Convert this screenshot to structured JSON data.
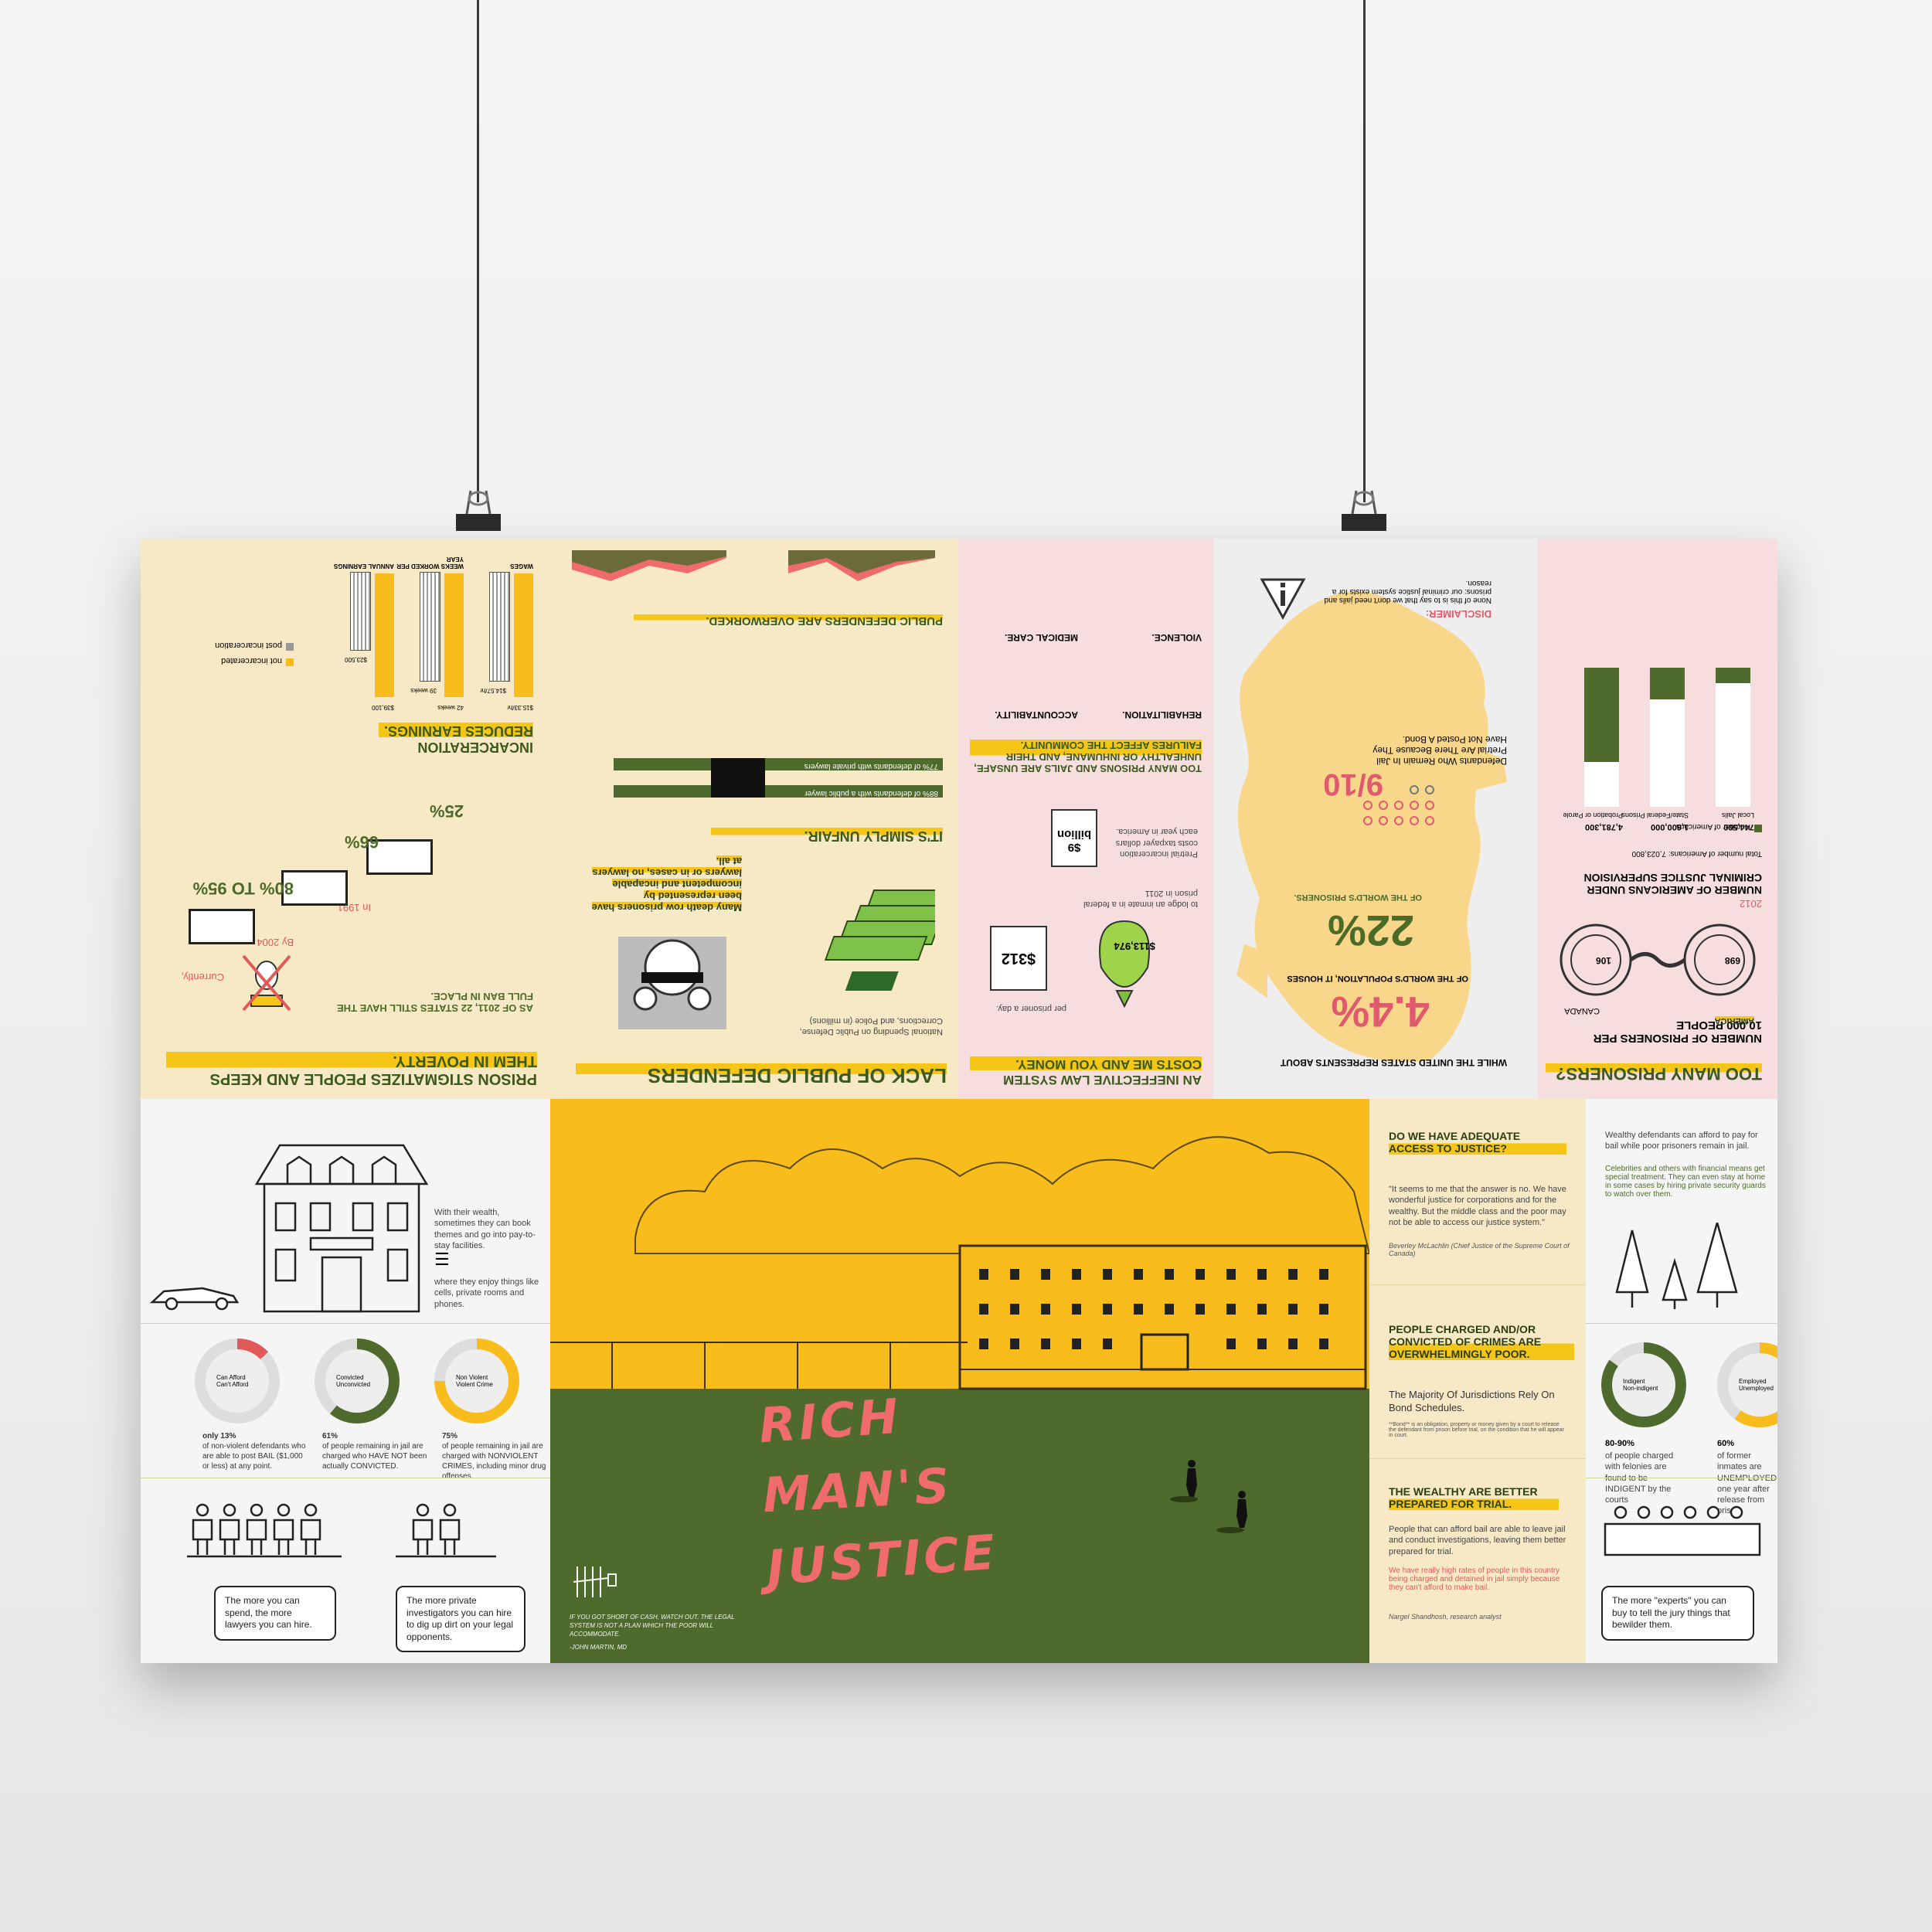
{
  "poster": {
    "title_lines": [
      "RICH",
      "MAN'S",
      "JUSTICE"
    ],
    "quote": "IF YOU GOT SHORT OF CASH, WATCH OUT. THE LEGAL SYSTEM IS NOT A PLAN WHICH THE POOR WILL ACCOMMODATE.",
    "quote_author": "-JOHN MARTIN, MD"
  },
  "upper": {
    "too_many_prisoners": {
      "heading": "TOO MANY PRISONERS?",
      "per10000_title": "NUMBER OF PRISONERS PER 10,000 PEOPLE",
      "america_label": "AMERICA",
      "america_value": "698",
      "canada_label": "CANADA",
      "canada_value": "106",
      "supervision_title": "NUMBER OF AMERICANS UNDER CRIMINAL JUSTICE SUPERVISION",
      "supervision_year": "2012",
      "supervision_total": "Total number of Americans: 7,023,800",
      "legend": "Number of Americans",
      "bars": [
        {
          "label": "Local Jails",
          "value": "744,500",
          "fraction": 0.11
        },
        {
          "label": "State/Federal Prisons",
          "value": "1,600,000",
          "fraction": 0.23
        },
        {
          "label": "Probation or Parole",
          "value": "4,781,300",
          "fraction": 0.68
        }
      ]
    },
    "map": {
      "intro": "WHILE THE UNITED STATES REPRESENTS ABOUT",
      "pct1": "4.4%",
      "pct1_caption": "OF THE WORLD'S POPULATION, IT HOUSES",
      "pct2": "22%",
      "pct2_caption": "OF THE WORLD'S PRISONERS.",
      "fraction": "9/10",
      "fraction_caption": "Defendants Who Remain In Jail Pretrial Are There Because They Have Not Posted A Bond.",
      "disclaimer_label": "DISCLAIMER:",
      "disclaimer_text": "None of this is to say that we don't need jails and prisons: our criminal justice system exists for a reason."
    },
    "ineffective": {
      "heading": "AN INEFFECTIVE LAW SYSTEM COSTS ME AND YOU MONEY.",
      "too_many_heading": "TOO MANY PRISONS AND JAILS ARE UNSAFE, UNHEALTHY OR INHUMANE, AND THEIR FAILURES AFFECT THE COMMUNITY.",
      "cost1_value": "$312",
      "cost1_caption": "per prisoner a day.",
      "cost2_value": "$113,974",
      "cost2_caption": "to lodge an inmate in a federal prison in 2011",
      "cost3_value": "$9 billion",
      "cost3_caption": "Pretrial incarceration costs taxpayer dollars each year in America.",
      "items": [
        "REHABILITATION.",
        "ACCOUNTABILITY.",
        "VIOLENCE.",
        "MEDICAL CARE."
      ]
    },
    "public_defenders": {
      "heading": "LACK OF PUBLIC DEFENDERS",
      "overworked": "PUBLIC DEFENDERS ARE OVERWORKED.",
      "unfair": "IT'S SIMPLY UNFAIR.",
      "death_row": "Many death row prisoners have been represented by incompetent and incapable lawyers or in cases, no lawyers at all.",
      "spending_caption": "National Spending on Public Defense, Corrections, and Police (in millions)",
      "bar1": "77% of defendants with private lawyers",
      "bar2": "88% of defendants with a public lawyer"
    },
    "stigma": {
      "heading": "PRISON STIGMATIZES PEOPLE AND KEEPS THEM IN POVERTY.",
      "earnings": "INCARCERATION REDUCES EARNINGS.",
      "ban": "AS OF 2011, 22 STATES STILL HAVE THE FULL BAN IN PLACE.",
      "year1": "In 1991,",
      "year2": "By 2004",
      "year3": "Currently,",
      "pct_a": "25%",
      "pct_b": "66%",
      "pct_c": "80% TO 95%",
      "legend_a": "not incarcerated",
      "legend_b": "post incarceration",
      "chart_labels": [
        "WAGES",
        "WEEKS WORKED PER YEAR",
        "ANNUAL EARNINGS"
      ],
      "chart_values": [
        "$15.33/hr",
        "$14.57/hr",
        "42 weeks",
        "39 weeks",
        "$39,100",
        "$23,500"
      ]
    }
  },
  "lower": {
    "wealth": {
      "text1": "With their wealth, sometimes they can book themes and go into pay-to-stay facilities.",
      "text2": "where they enjoy things like cells, private rooms and phones."
    },
    "stats": [
      {
        "pct": "only 13%",
        "text": "of non-violent defendants who are able to post BAIL ($1,000 or less) at any point."
      },
      {
        "pct": "61%",
        "text": "of people remaining in jail are charged who HAVE NOT been actually CONVICTED."
      },
      {
        "pct": "75%",
        "text": "of people remaining in jail are charged with NONVIOLENT CRIMES, including minor drug offenses."
      }
    ],
    "donut_labels": [
      [
        "Can Afford",
        "Can't Afford"
      ],
      [
        "Convicted",
        "Unconvicted"
      ],
      [
        "Non Violent",
        "Violent Crime"
      ]
    ],
    "bubble1": "The more you can spend, the more lawyers you can hire.",
    "bubble2": "The more private investigators you can hire to dig up dirt on your legal opponents.",
    "access": {
      "heading": "DO WE HAVE ADEQUATE ACCESS TO JUSTICE?",
      "quote": "\"It seems to me that the answer is no. We have wonderful justice for corporations and for the wealthy. But the middle class and the poor may not be able to access our justice system.\"",
      "author": "Beverley McLachlin (Chief Justice of the Supreme Court of Canada)"
    },
    "poor": {
      "heading": "PEOPLE CHARGED AND/OR CONVICTED OF CRIMES ARE OVERWHELMINGLY POOR.",
      "text": "The Majority Of Jurisdictions Rely On Bond Schedules.",
      "fine": "**Bond** is an obligation, property or money given by a court to release the defendant from prison before trial, on the condition that he will appear in court."
    },
    "prepared": {
      "heading": "THE WEALTHY ARE BETTER PREPARED FOR TRIAL.",
      "text": "People that can afford bail are able to leave jail and conduct investigations, leaving them better prepared for trial.",
      "quote": "We have really high rates of people in this country being charged and detained in jail simply because they can't afford to make bail.",
      "author": "Nargel Shandhosh, research analyst"
    },
    "right": {
      "text1": "Wealthy defendants can afford to pay for bail while poor prisoners remain in jail.",
      "text2": "Celebrities and others with financial means get special treatment. They can even stay at home in some cases by hiring private security guards to watch over them.",
      "stat1_pct": "80-90%",
      "stat1_text": "of people charged with felonies are found to be INDIGENT by the courts",
      "stat2_pct": "60%",
      "stat2_text": "of former inmates are UNEMPLOYED one year after release from prison",
      "donut_labels": [
        "Indigent",
        "Non-indigent"
      ],
      "donut2_labels": [
        "Employed",
        "Unemployed"
      ],
      "bubble": "The more \"experts\" you can buy to tell the jury things that bewilder them."
    }
  },
  "colors": {
    "yellow": "#f8bc1c",
    "green": "#4e6a2c",
    "pink": "#f06b6b",
    "beige": "#f7e8c6"
  }
}
